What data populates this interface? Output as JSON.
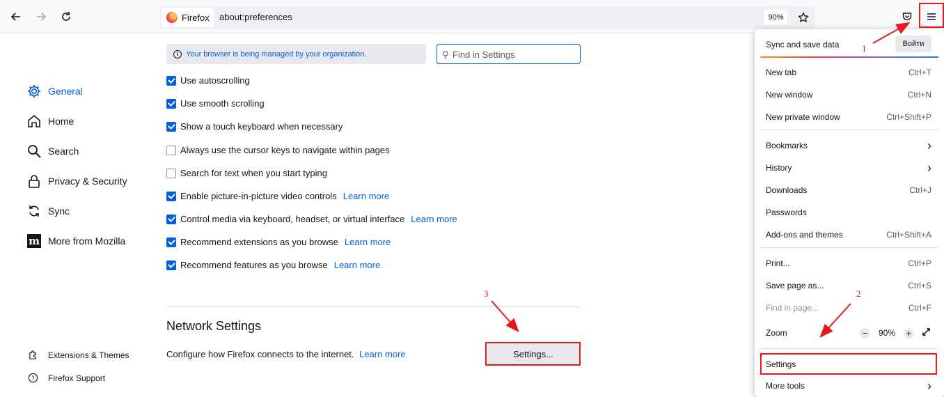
{
  "toolbar": {
    "tab_label": "Firefox",
    "url": "about:preferences",
    "zoom": "90%"
  },
  "policy_notice": "Your browser is being managed by your organization.",
  "search": {
    "placeholder": "Find in Settings"
  },
  "sidebar": {
    "items": [
      {
        "label": "General",
        "icon": "gear-icon",
        "selected": true
      },
      {
        "label": "Home",
        "icon": "home-icon"
      },
      {
        "label": "Search",
        "icon": "search-icon"
      },
      {
        "label": "Privacy & Security",
        "icon": "lock-icon"
      },
      {
        "label": "Sync",
        "icon": "sync-icon"
      },
      {
        "label": "More from Mozilla",
        "icon": "mozilla-icon"
      }
    ],
    "footer": [
      {
        "label": "Extensions & Themes",
        "icon": "puzzle-icon"
      },
      {
        "label": "Firefox Support",
        "icon": "help-icon"
      }
    ]
  },
  "options": [
    {
      "label": "Use autoscrolling",
      "checked": true
    },
    {
      "label": "Use smooth scrolling",
      "checked": true
    },
    {
      "label": "Show a touch keyboard when necessary",
      "checked": true
    },
    {
      "label": "Always use the cursor keys to navigate within pages",
      "checked": false
    },
    {
      "label": "Search for text when you start typing",
      "checked": false
    },
    {
      "label": "Enable picture-in-picture video controls",
      "checked": true,
      "link": "Learn more"
    },
    {
      "label": "Control media via keyboard, headset, or virtual interface",
      "checked": true,
      "link": "Learn more"
    },
    {
      "label": "Recommend extensions as you browse",
      "checked": true,
      "link": "Learn more"
    },
    {
      "label": "Recommend features as you browse",
      "checked": true,
      "link": "Learn more"
    }
  ],
  "network": {
    "heading": "Network Settings",
    "description": "Configure how Firefox connects to the internet.",
    "link": "Learn more",
    "button": "Settings..."
  },
  "menu": {
    "sync_label": "Sync and save data",
    "signin_button": "Войти",
    "items": [
      {
        "label": "New tab",
        "shortcut": "Ctrl+T"
      },
      {
        "label": "New window",
        "shortcut": "Ctrl+N"
      },
      {
        "label": "New private window",
        "shortcut": "Ctrl+Shift+P"
      },
      {
        "label": "Bookmarks",
        "shortcut": "›"
      },
      {
        "label": "History",
        "shortcut": "›"
      },
      {
        "label": "Downloads",
        "shortcut": "Ctrl+J"
      },
      {
        "label": "Passwords",
        "shortcut": ""
      },
      {
        "label": "Add-ons and themes",
        "shortcut": "Ctrl+Shift+A"
      },
      {
        "label": "Print...",
        "shortcut": "Ctrl+P"
      },
      {
        "label": "Save page as...",
        "shortcut": "Ctrl+S"
      },
      {
        "label": "Find in page...",
        "shortcut": "Ctrl+F"
      }
    ],
    "zoom_label": "Zoom",
    "zoom_value": "90%",
    "zoom_minus": "−",
    "zoom_plus": "+",
    "settings": "Settings",
    "more_tools": "More tools",
    "more_tools_arrow": "›"
  },
  "annotations": {
    "step1": "1",
    "step2": "2",
    "step3": "3",
    "color": "#e3191c"
  }
}
